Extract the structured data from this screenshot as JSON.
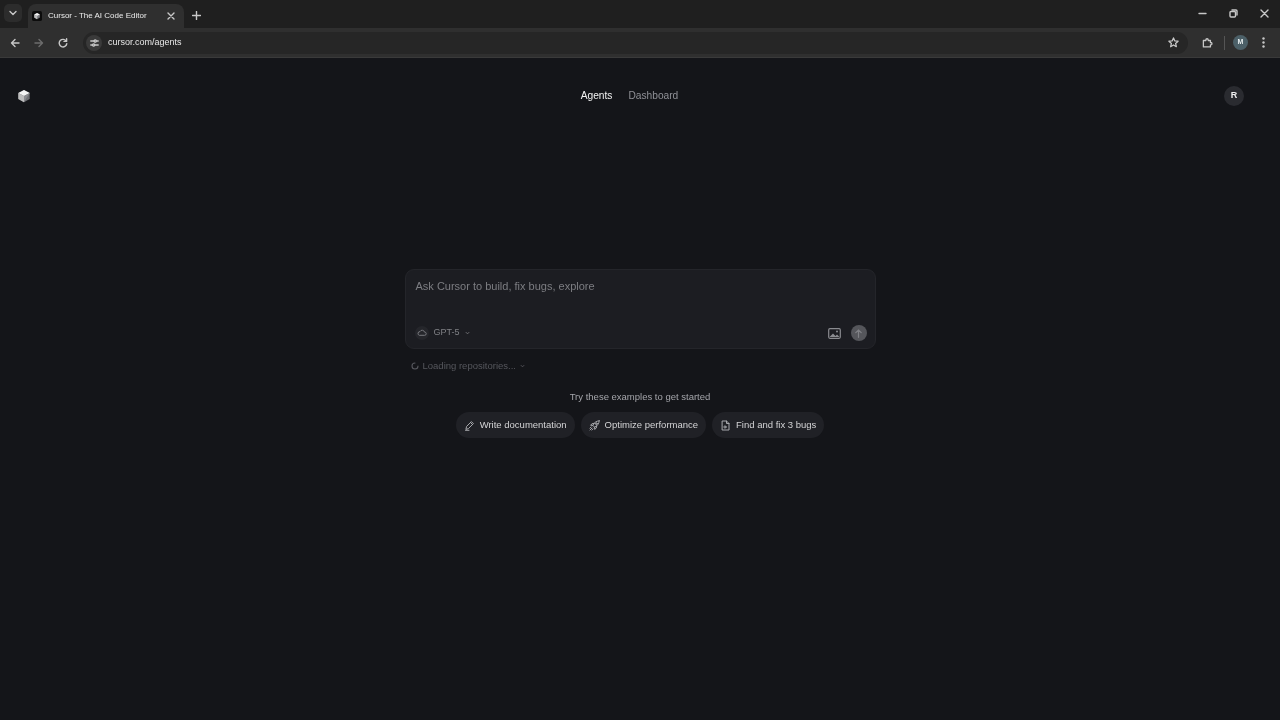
{
  "browser": {
    "tabs": [
      {
        "title": "Cursor - The AI Code Editor",
        "selected": true
      }
    ],
    "toolbar": {
      "nav_buttons": [
        {
          "kind": "back",
          "disabled": false
        },
        {
          "kind": "forward",
          "disabled": true
        },
        {
          "kind": "reload",
          "disabled": false
        }
      ],
      "address": "cursor.com/agents",
      "profile_initial": "M"
    }
  },
  "header": {
    "nav": [
      {
        "label": "Agents",
        "selected": true
      },
      {
        "label": "Dashboard",
        "selected": false
      }
    ],
    "avatar_initial": "R"
  },
  "composer": {
    "placeholder": "Ask Cursor to build, fix bugs, explore",
    "model": "GPT-5",
    "send_button": {
      "disabled": true
    }
  },
  "repository_status": "Loading repositories...",
  "examples": {
    "heading": "Try these examples to get started",
    "items": [
      {
        "kind": "pen",
        "label": "Write documentation"
      },
      {
        "kind": "rocket",
        "label": "Optimize performance"
      },
      {
        "kind": "file",
        "label": "Find and fix 3 bugs"
      }
    ]
  }
}
